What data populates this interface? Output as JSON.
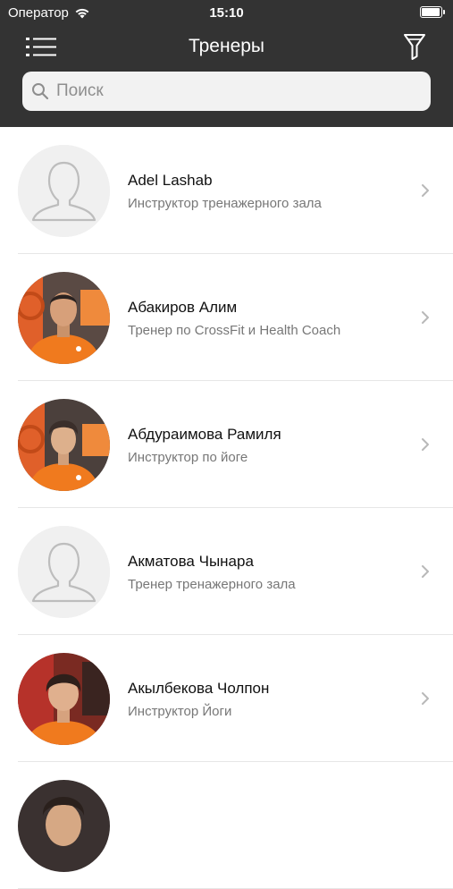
{
  "status_bar": {
    "carrier": "Оператор",
    "time": "15:10"
  },
  "nav": {
    "title": "Тренеры",
    "menu_icon": "hamburger-menu-icon",
    "filter_icon": "filter-funnel-icon"
  },
  "search": {
    "placeholder": "Поиск",
    "value": ""
  },
  "colors": {
    "header_bg": "#333333",
    "orange_shirt": "#f07a1e"
  },
  "trainers": [
    {
      "name": "Adel Lashab",
      "role": "Инструктор тренажерного зала",
      "avatar": "placeholder"
    },
    {
      "name": "Абакиров Алим",
      "role": "Тренер по CrossFit и Health Coach",
      "avatar": "photo"
    },
    {
      "name": "Абдураимова Рамиля",
      "role": "Инструктор по йоге",
      "avatar": "photo"
    },
    {
      "name": "Акматова Чынара",
      "role": "Тренер тренажерного зала",
      "avatar": "placeholder"
    },
    {
      "name": "Акылбекова Чолпон",
      "role": "Инструктор Йоги",
      "avatar": "photo"
    },
    {
      "name": "",
      "role": "",
      "avatar": "photo"
    }
  ]
}
